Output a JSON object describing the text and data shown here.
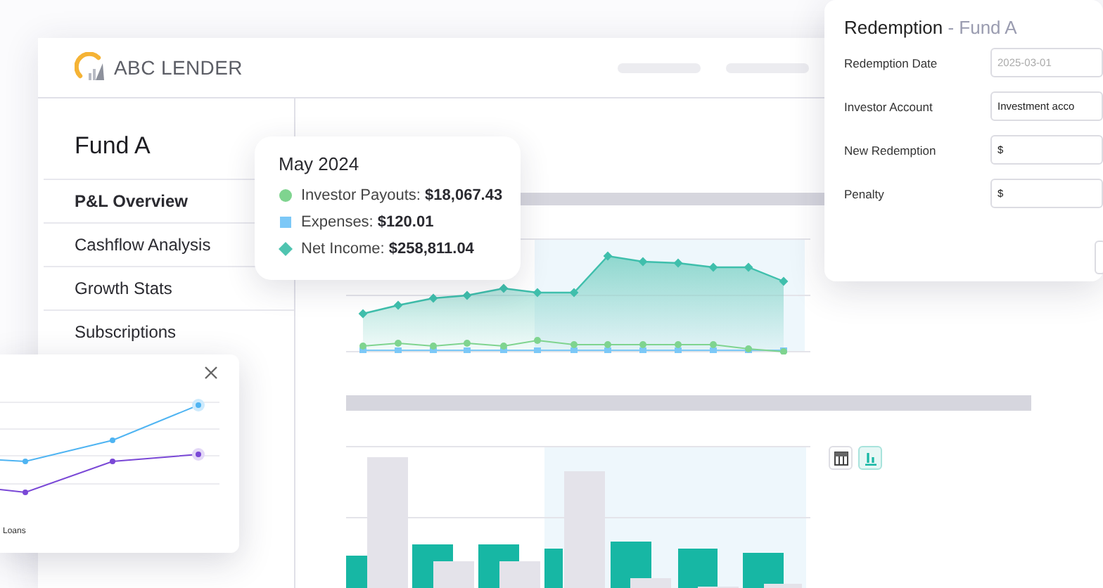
{
  "app": {
    "logo": "ABC LENDER"
  },
  "sidebar": {
    "title": "Fund A",
    "items": [
      {
        "label": "P&L Overview",
        "selected": true
      },
      {
        "label": "Cashflow Analysis",
        "selected": false
      },
      {
        "label": "Growth Stats",
        "selected": false
      },
      {
        "label": "Subscriptions",
        "selected": false
      }
    ]
  },
  "tooltip": {
    "title": "May 2024",
    "entries": [
      {
        "kind": "circle",
        "color": "#7fd48f",
        "label": "Investor Payouts:",
        "value": "$18,067.43"
      },
      {
        "kind": "square",
        "color": "#7cc8f7",
        "label": "Expenses:",
        "value": "$120.01"
      },
      {
        "kind": "diamond",
        "color": "#4fc4b0",
        "label": "Net Income:",
        "value": "$258,811.04"
      }
    ]
  },
  "chart_toggle": [
    {
      "kind": "table",
      "selected": false
    },
    {
      "kind": "bar",
      "selected": true
    }
  ],
  "dialog": {
    "title": "Redemption",
    "subtitle": "- Fund A",
    "fields": [
      {
        "label": "Redemption Date",
        "placeholder": "2025-03-01"
      },
      {
        "label": "Investor Account",
        "value": "Investment acco"
      },
      {
        "label": "New Redemption",
        "value": "$"
      },
      {
        "label": "Penalty",
        "value": "$"
      }
    ]
  },
  "popup": {
    "legend": "Loans"
  }
}
